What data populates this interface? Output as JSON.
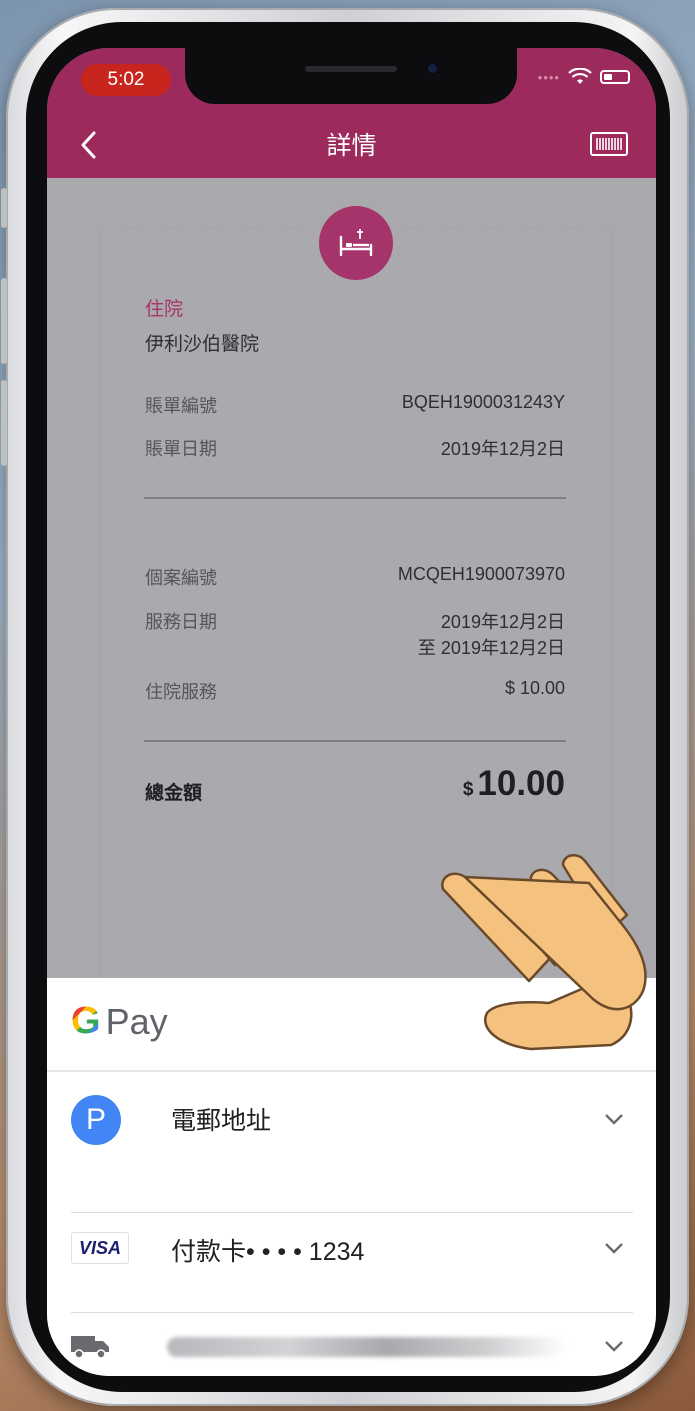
{
  "status_bar": {
    "time": "5:02"
  },
  "header": {
    "title": "詳情"
  },
  "receipt": {
    "category": "住院",
    "hospital": "伊利沙伯醫院",
    "bill_fields": [
      {
        "label": "賬單編號",
        "value": "BQEH1900031243Y"
      },
      {
        "label": "賬單日期",
        "value": "2019年12月2日"
      }
    ],
    "case_fields": {
      "case_no": {
        "label": "個案編號",
        "value": "MCQEH1900073970"
      },
      "service_date": {
        "label": "服務日期",
        "value_line1": "2019年12月2日",
        "value_line2": "至 2019年12月2日"
      },
      "service": {
        "label": "住院服務",
        "value": "$ 10.00"
      }
    },
    "total": {
      "label": "總金額",
      "currency": "$",
      "amount": "10.00"
    }
  },
  "gpay": {
    "logo_g": "G",
    "logo_pay": "Pay",
    "rows": [
      {
        "icon": "p-icon",
        "icon_text": "P",
        "label": "電郵地址"
      },
      {
        "icon": "visa-icon",
        "icon_text": "VISA",
        "label": "付款卡• • • • 1234"
      },
      {
        "icon": "truck-icon",
        "label": ""
      }
    ]
  },
  "colors": {
    "brand": "#9c2a5c",
    "accent_pink": "#a8346b",
    "google_blue": "#4285f4",
    "dim_overlay": "#a9a8ac"
  }
}
